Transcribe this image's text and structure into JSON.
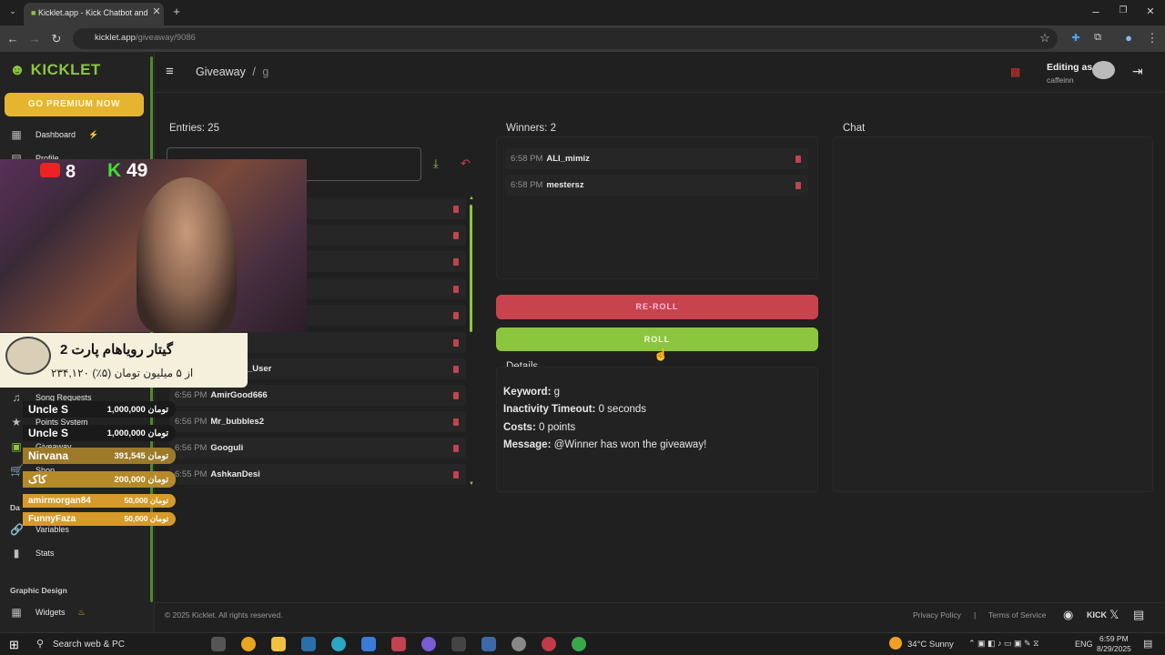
{
  "browser": {
    "tab_title": "Kicklet.app - Kick Chatbot and",
    "url_host": "kicklet.app",
    "url_path": "/giveaway/9086"
  },
  "sidebar": {
    "logo": "KICKLET",
    "premium": "GO PREMIUM NOW",
    "items": [
      {
        "label": "Dashboard",
        "icon": "dashboard-icon"
      },
      {
        "label": "Profile",
        "icon": "profile-icon"
      },
      {
        "label": "Song Requests",
        "icon": "music-icon"
      },
      {
        "label": "Points System",
        "icon": "star-icon"
      },
      {
        "label": "Giveaway",
        "icon": "gift-icon"
      },
      {
        "label": "Shop",
        "icon": "cart-icon"
      },
      {
        "label": "Variables",
        "icon": "link-icon"
      },
      {
        "label": "Stats",
        "icon": "stats-icon"
      },
      {
        "label": "Widgets",
        "icon": "widgets-icon"
      }
    ],
    "sections": {
      "data": "Da",
      "graphic": "Graphic Design"
    }
  },
  "header": {
    "breadcrumb": "Giveaway",
    "sep": "/",
    "current": "g",
    "editing_as": "Editing as",
    "user": "caffeinn"
  },
  "entries": {
    "title": "Entries: 25",
    "rows": [
      {
        "time": "",
        "name": "_User"
      },
      {
        "time": "6:56 PM",
        "name": "AmirGood666"
      },
      {
        "time": "6:56 PM",
        "name": "Mr_bubbles2"
      },
      {
        "time": "6:56 PM",
        "name": "Googuli"
      },
      {
        "time": "6:55 PM",
        "name": "AshkanDesi"
      }
    ]
  },
  "winners": {
    "title": "Winners: 2",
    "rows": [
      {
        "time": "6:58 PM",
        "name": "ALI_mimiz"
      },
      {
        "time": "6:58 PM",
        "name": "mestersz"
      }
    ]
  },
  "buttons": {
    "reroll": "RE-ROLL",
    "roll": "ROLL"
  },
  "details": {
    "title": "Details",
    "keyword_label": "Keyword:",
    "keyword": "g",
    "timeout_label": "Inactivity Timeout:",
    "timeout": "0 seconds",
    "costs_label": "Costs:",
    "costs": "0 points",
    "message_label": "Message:",
    "message": "@Winner has won the giveaway!"
  },
  "chat": {
    "title": "Chat"
  },
  "footer": {
    "copyright": "© 2025 Kicklet. All rights reserved.",
    "privacy": "Privacy Policy",
    "sep": "|",
    "terms": "Terms of Service"
  },
  "overlay": {
    "youtube_count": "8",
    "kick_count": "49",
    "banner_title": "گیتار رویاهام پارت 2",
    "banner_sub": "۲۳۴,۱۲۰ از ۵ میلیون تومان (۵٪)",
    "donations": [
      {
        "name": "Uncle S",
        "amount": "1,000,000 تومان"
      },
      {
        "name": "Uncle S",
        "amount": "1,000,000 تومان"
      },
      {
        "name": "Nirvana",
        "amount": "391,545 تومان"
      },
      {
        "name": "کاک",
        "amount": "200,000 تومان"
      },
      {
        "name": "amirmorgan84",
        "amount": "50,000 تومان"
      },
      {
        "name": "FunnyFaza",
        "amount": "50,000 تومان"
      }
    ]
  },
  "taskbar": {
    "search": "Search web & PC",
    "weather": "34°C  Sunny",
    "lang": "ENG",
    "time": "6:59 PM",
    "date": "8/29/2025"
  },
  "colors": {
    "accent_green": "#8cc63f",
    "reroll_red": "#c9434f",
    "premium_gold": "#e6b530"
  }
}
